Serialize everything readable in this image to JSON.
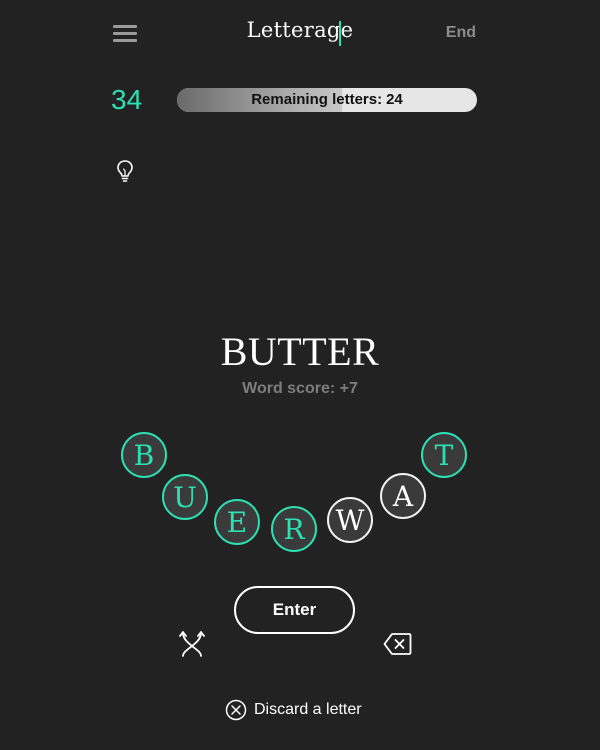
{
  "header": {
    "title": "Letterage",
    "end_label": "End",
    "menu_icon": "hamburger-menu-icon"
  },
  "status": {
    "score": "34",
    "remaining_label": "Remaining letters:",
    "remaining_count": "24",
    "progress_fraction": 0.55
  },
  "hint": {
    "icon": "lightbulb-icon"
  },
  "current_word": {
    "text": "BUTTER",
    "score_text": "Word score: +7"
  },
  "tiles": [
    {
      "letter": "B",
      "state": "used"
    },
    {
      "letter": "U",
      "state": "used"
    },
    {
      "letter": "E",
      "state": "used"
    },
    {
      "letter": "R",
      "state": "used"
    },
    {
      "letter": "W",
      "state": "free"
    },
    {
      "letter": "A",
      "state": "free"
    },
    {
      "letter": "T",
      "state": "used"
    }
  ],
  "controls": {
    "enter_label": "Enter",
    "shuffle_icon": "shuffle-icon",
    "backspace_icon": "backspace-icon",
    "discard_label": "Discard a letter",
    "discard_icon": "circle-x-icon"
  },
  "colors": {
    "background": "#222222",
    "accent": "#2de0b4",
    "text": "#ffffff",
    "muted": "#8c8c8c"
  }
}
